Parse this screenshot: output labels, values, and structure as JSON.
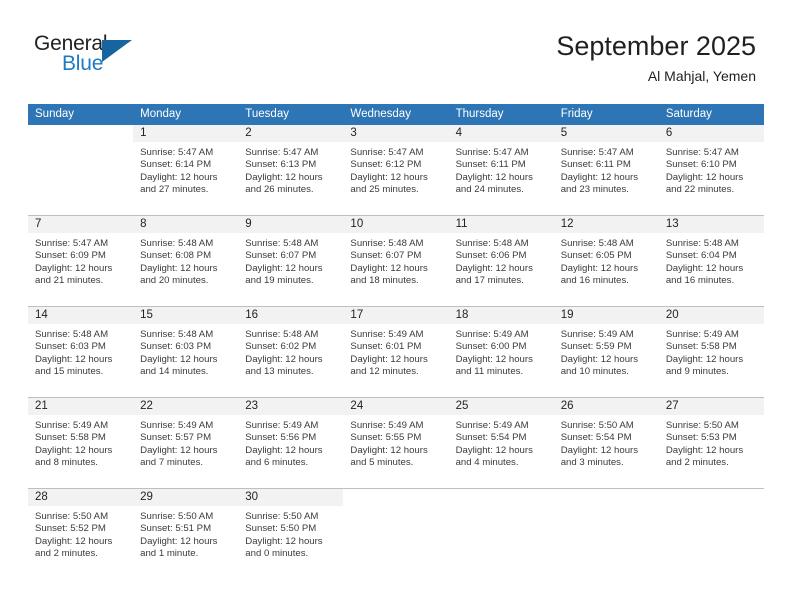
{
  "logo": {
    "word_top": "General",
    "word_bottom": "Blue",
    "triangle_color": "#16659f",
    "blue_color": "#1f7ac4"
  },
  "header": {
    "title": "September 2025",
    "subtitle": "Al Mahjal, Yemen"
  },
  "theme": {
    "header_row_bg": "#2e75b6",
    "header_row_text": "#ffffff",
    "daynum_band_bg": "#f2f2f2",
    "cell_border": "#bfbfbf",
    "text": "#231f20"
  },
  "weekday_headers": [
    "Sunday",
    "Monday",
    "Tuesday",
    "Wednesday",
    "Thursday",
    "Friday",
    "Saturday"
  ],
  "labels": {
    "sunrise_prefix": "Sunrise:",
    "sunset_prefix": "Sunset:",
    "daylight_prefix": "Daylight:"
  },
  "weeks": [
    [
      {
        "day": "",
        "lines": []
      },
      {
        "day": "1",
        "lines": [
          "Sunrise: 5:47 AM",
          "Sunset: 6:14 PM",
          "Daylight: 12 hours",
          "and 27 minutes."
        ]
      },
      {
        "day": "2",
        "lines": [
          "Sunrise: 5:47 AM",
          "Sunset: 6:13 PM",
          "Daylight: 12 hours",
          "and 26 minutes."
        ]
      },
      {
        "day": "3",
        "lines": [
          "Sunrise: 5:47 AM",
          "Sunset: 6:12 PM",
          "Daylight: 12 hours",
          "and 25 minutes."
        ]
      },
      {
        "day": "4",
        "lines": [
          "Sunrise: 5:47 AM",
          "Sunset: 6:11 PM",
          "Daylight: 12 hours",
          "and 24 minutes."
        ]
      },
      {
        "day": "5",
        "lines": [
          "Sunrise: 5:47 AM",
          "Sunset: 6:11 PM",
          "Daylight: 12 hours",
          "and 23 minutes."
        ]
      },
      {
        "day": "6",
        "lines": [
          "Sunrise: 5:47 AM",
          "Sunset: 6:10 PM",
          "Daylight: 12 hours",
          "and 22 minutes."
        ]
      }
    ],
    [
      {
        "day": "7",
        "lines": [
          "Sunrise: 5:47 AM",
          "Sunset: 6:09 PM",
          "Daylight: 12 hours",
          "and 21 minutes."
        ]
      },
      {
        "day": "8",
        "lines": [
          "Sunrise: 5:48 AM",
          "Sunset: 6:08 PM",
          "Daylight: 12 hours",
          "and 20 minutes."
        ]
      },
      {
        "day": "9",
        "lines": [
          "Sunrise: 5:48 AM",
          "Sunset: 6:07 PM",
          "Daylight: 12 hours",
          "and 19 minutes."
        ]
      },
      {
        "day": "10",
        "lines": [
          "Sunrise: 5:48 AM",
          "Sunset: 6:07 PM",
          "Daylight: 12 hours",
          "and 18 minutes."
        ]
      },
      {
        "day": "11",
        "lines": [
          "Sunrise: 5:48 AM",
          "Sunset: 6:06 PM",
          "Daylight: 12 hours",
          "and 17 minutes."
        ]
      },
      {
        "day": "12",
        "lines": [
          "Sunrise: 5:48 AM",
          "Sunset: 6:05 PM",
          "Daylight: 12 hours",
          "and 16 minutes."
        ]
      },
      {
        "day": "13",
        "lines": [
          "Sunrise: 5:48 AM",
          "Sunset: 6:04 PM",
          "Daylight: 12 hours",
          "and 16 minutes."
        ]
      }
    ],
    [
      {
        "day": "14",
        "lines": [
          "Sunrise: 5:48 AM",
          "Sunset: 6:03 PM",
          "Daylight: 12 hours",
          "and 15 minutes."
        ]
      },
      {
        "day": "15",
        "lines": [
          "Sunrise: 5:48 AM",
          "Sunset: 6:03 PM",
          "Daylight: 12 hours",
          "and 14 minutes."
        ]
      },
      {
        "day": "16",
        "lines": [
          "Sunrise: 5:48 AM",
          "Sunset: 6:02 PM",
          "Daylight: 12 hours",
          "and 13 minutes."
        ]
      },
      {
        "day": "17",
        "lines": [
          "Sunrise: 5:49 AM",
          "Sunset: 6:01 PM",
          "Daylight: 12 hours",
          "and 12 minutes."
        ]
      },
      {
        "day": "18",
        "lines": [
          "Sunrise: 5:49 AM",
          "Sunset: 6:00 PM",
          "Daylight: 12 hours",
          "and 11 minutes."
        ]
      },
      {
        "day": "19",
        "lines": [
          "Sunrise: 5:49 AM",
          "Sunset: 5:59 PM",
          "Daylight: 12 hours",
          "and 10 minutes."
        ]
      },
      {
        "day": "20",
        "lines": [
          "Sunrise: 5:49 AM",
          "Sunset: 5:58 PM",
          "Daylight: 12 hours",
          "and 9 minutes."
        ]
      }
    ],
    [
      {
        "day": "21",
        "lines": [
          "Sunrise: 5:49 AM",
          "Sunset: 5:58 PM",
          "Daylight: 12 hours",
          "and 8 minutes."
        ]
      },
      {
        "day": "22",
        "lines": [
          "Sunrise: 5:49 AM",
          "Sunset: 5:57 PM",
          "Daylight: 12 hours",
          "and 7 minutes."
        ]
      },
      {
        "day": "23",
        "lines": [
          "Sunrise: 5:49 AM",
          "Sunset: 5:56 PM",
          "Daylight: 12 hours",
          "and 6 minutes."
        ]
      },
      {
        "day": "24",
        "lines": [
          "Sunrise: 5:49 AM",
          "Sunset: 5:55 PM",
          "Daylight: 12 hours",
          "and 5 minutes."
        ]
      },
      {
        "day": "25",
        "lines": [
          "Sunrise: 5:49 AM",
          "Sunset: 5:54 PM",
          "Daylight: 12 hours",
          "and 4 minutes."
        ]
      },
      {
        "day": "26",
        "lines": [
          "Sunrise: 5:50 AM",
          "Sunset: 5:54 PM",
          "Daylight: 12 hours",
          "and 3 minutes."
        ]
      },
      {
        "day": "27",
        "lines": [
          "Sunrise: 5:50 AM",
          "Sunset: 5:53 PM",
          "Daylight: 12 hours",
          "and 2 minutes."
        ]
      }
    ],
    [
      {
        "day": "28",
        "lines": [
          "Sunrise: 5:50 AM",
          "Sunset: 5:52 PM",
          "Daylight: 12 hours",
          "and 2 minutes."
        ]
      },
      {
        "day": "29",
        "lines": [
          "Sunrise: 5:50 AM",
          "Sunset: 5:51 PM",
          "Daylight: 12 hours",
          "and 1 minute."
        ]
      },
      {
        "day": "30",
        "lines": [
          "Sunrise: 5:50 AM",
          "Sunset: 5:50 PM",
          "Daylight: 12 hours",
          "and 0 minutes."
        ]
      },
      {
        "day": "",
        "lines": []
      },
      {
        "day": "",
        "lines": []
      },
      {
        "day": "",
        "lines": []
      },
      {
        "day": "",
        "lines": []
      }
    ]
  ]
}
